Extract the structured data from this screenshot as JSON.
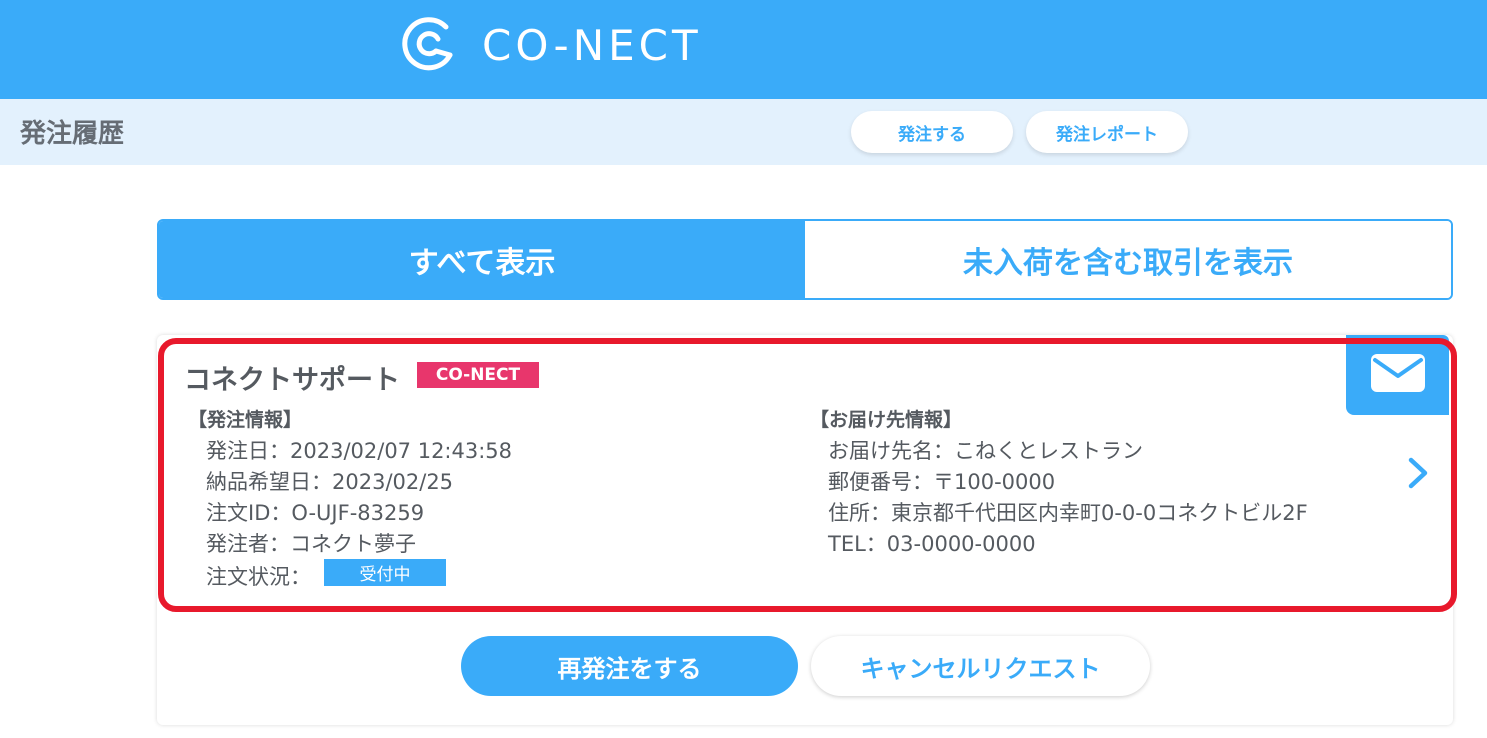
{
  "header": {
    "logo_text": "CO-NECT",
    "brand_color": "#3aabf9",
    "logo_icon": "conect-logo-icon"
  },
  "subheader": {
    "title": "発注履歴",
    "order_button": "発注する",
    "report_button": "発注レポート"
  },
  "tabs": [
    {
      "label": "すべて表示",
      "active": true
    },
    {
      "label": "未入荷を含む取引を表示",
      "active": false
    }
  ],
  "order_card": {
    "supplier_name": "コネクトサポート",
    "brand_badge": "CO-NECT",
    "brand_badge_color": "#e8366c",
    "mail_icon": "mail-icon",
    "order_info": {
      "heading": "【発注情報】",
      "order_date": "発注日：2023/02/07 12:43:58",
      "delivery_date": "納品希望日：2023/02/25",
      "order_id": "注文ID：O-UJF-83259",
      "orderer": "発注者：コネクト夢子",
      "status_label": "注文状況：",
      "status_value": "受付中"
    },
    "delivery_info": {
      "heading": "【お届け先情報】",
      "recipient": "お届け先名：こねくとレストラン",
      "postal_code": "郵便番号：〒100-0000",
      "address": "住所：東京都千代田区内幸町0-0-0コネクトビル2F",
      "tel": "TEL：03-0000-0000"
    },
    "detail_icon": "chevron-right-icon",
    "highlight_color": "#e8192c"
  },
  "actions": {
    "reorder": "再発注をする",
    "cancel_request": "キャンセルリクエスト"
  }
}
